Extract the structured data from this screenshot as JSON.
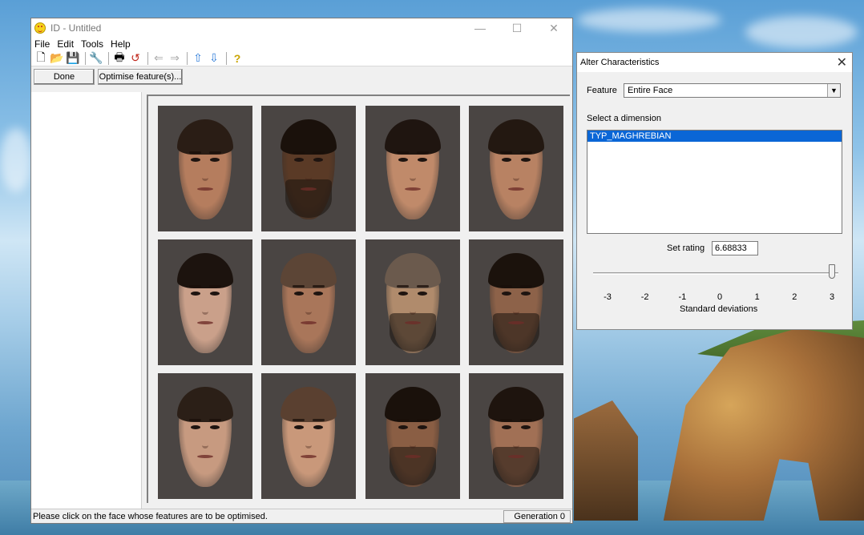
{
  "main_window": {
    "title": "ID - Untitled",
    "menu": [
      "File",
      "Edit",
      "Tools",
      "Help"
    ],
    "toolbar_icons": [
      "new-file-icon",
      "open-folder-icon",
      "save-icon",
      "wrench-icon",
      "print-icon",
      "undo-icon",
      "back-arrow-icon",
      "forward-arrow-icon",
      "up-arrow-icon",
      "down-arrow-icon",
      "help-icon"
    ],
    "done_label": "Done",
    "optimise_label": "Optimise feature(s)...",
    "status_text": "Please click on the face whose features are to be optimised.",
    "generation": "Generation 0",
    "faces_count": 12
  },
  "dialog": {
    "title": "Alter Characteristics",
    "feature_label": "Feature",
    "feature_value": "Entire Face",
    "dimension_label": "Select a dimension",
    "dimension_items": [
      "TYP_MAGHREBIAN"
    ],
    "rating_label": "Set rating",
    "rating_value": "6.68833",
    "slider_value": 3,
    "ticks": [
      "-3",
      "-2",
      "-1",
      "0",
      "1",
      "2",
      "3"
    ],
    "axis_caption": "Standard deviations"
  }
}
